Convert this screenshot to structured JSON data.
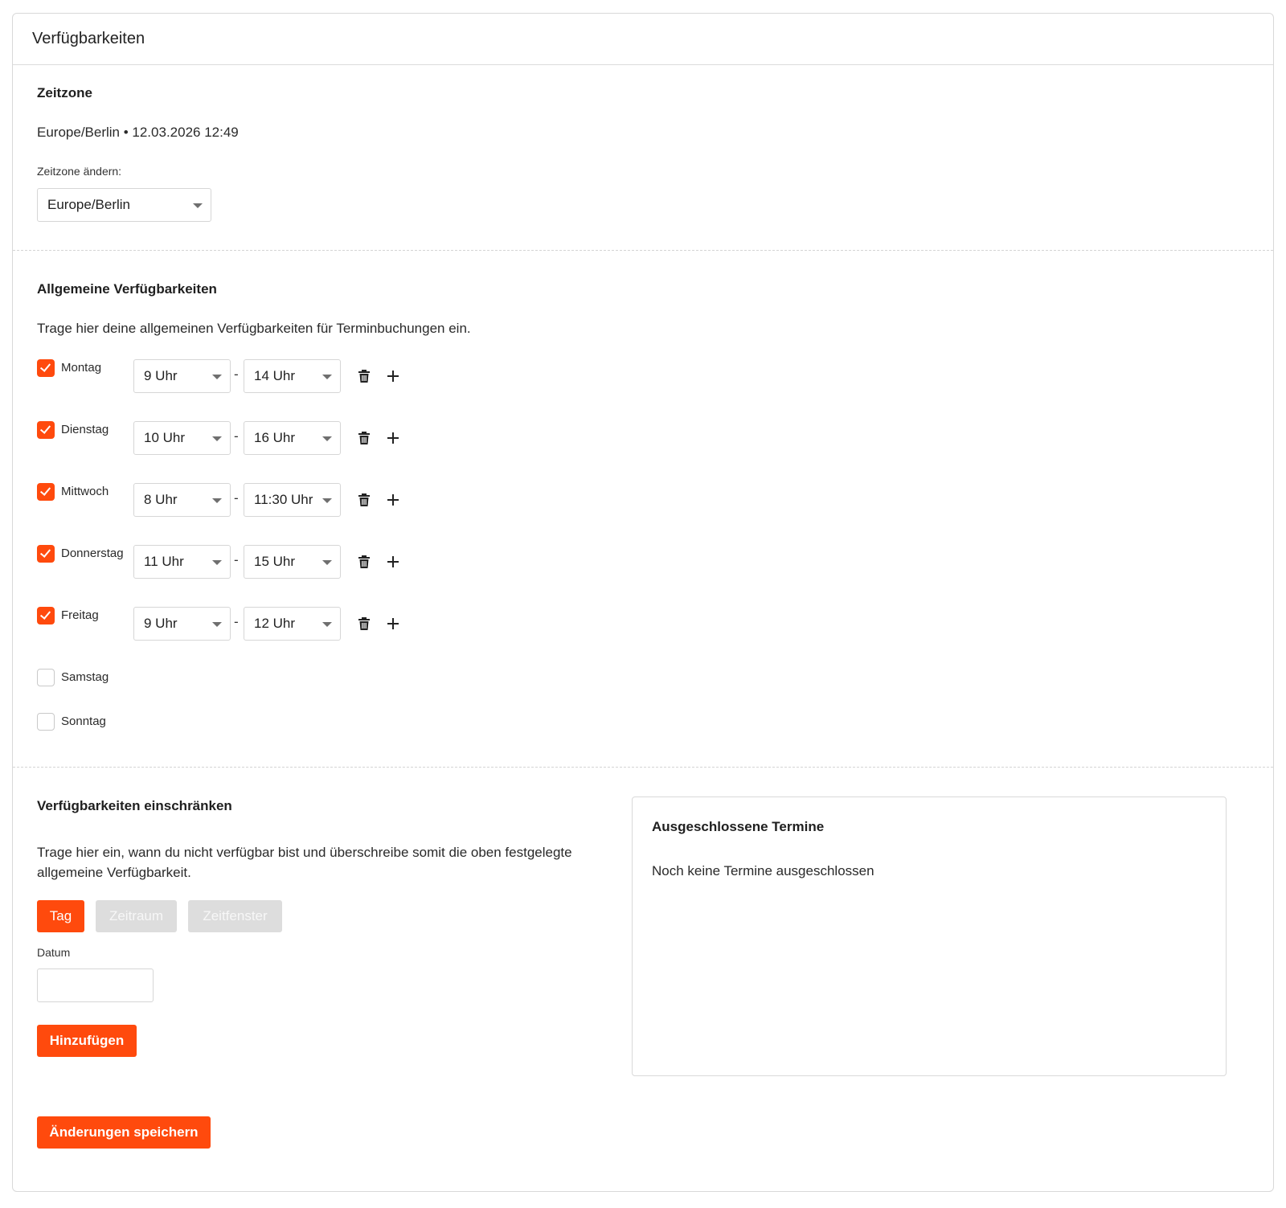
{
  "header": {
    "title": "Verfügbarkeiten"
  },
  "timezone": {
    "title": "Zeitzone",
    "current": "Europe/Berlin • 12.03.2026 12:49",
    "change_label": "Zeitzone ändern:",
    "selected": "Europe/Berlin"
  },
  "general": {
    "title": "Allgemeine Verfügbarkeiten",
    "description": "Trage hier deine allgemeinen Verfügbarkeiten für Terminbuchungen ein.",
    "separator": "-",
    "days": [
      {
        "label": "Montag",
        "checked": true,
        "from": "9 Uhr",
        "to": "14 Uhr"
      },
      {
        "label": "Dienstag",
        "checked": true,
        "from": "10 Uhr",
        "to": "16 Uhr"
      },
      {
        "label": "Mittwoch",
        "checked": true,
        "from": "8 Uhr",
        "to": "11:30 Uhr"
      },
      {
        "label": "Donnerstag",
        "checked": true,
        "from": "11 Uhr",
        "to": "15 Uhr"
      },
      {
        "label": "Freitag",
        "checked": true,
        "from": "9 Uhr",
        "to": "12 Uhr"
      },
      {
        "label": "Samstag",
        "checked": false
      },
      {
        "label": "Sonntag",
        "checked": false
      }
    ]
  },
  "restrict": {
    "title": "Verfügbarkeiten einschränken",
    "description_line1": "Trage hier ein, wann du nicht verfügbar bist und überschreibe somit die oben festgelegte",
    "description_line2": "allgemeine Verfügbarkeit.",
    "tabs": [
      "Tag",
      "Zeitraum",
      "Zeitfenster"
    ],
    "active_tab": "Tag",
    "date_label": "Datum",
    "date_value": "",
    "add_button": "Hinzufügen"
  },
  "excluded": {
    "title": "Ausgeschlossene Termine",
    "empty": "Noch keine Termine ausgeschlossen"
  },
  "save_button": "Änderungen speichern",
  "colors": {
    "accent": "#ff4a0d",
    "disabled": "#dddddd",
    "border": "#d9d9d9"
  },
  "icons": {
    "delete": "trash-icon",
    "add": "plus-icon",
    "dropdown": "chevron-down-icon",
    "check": "checkmark-icon"
  }
}
